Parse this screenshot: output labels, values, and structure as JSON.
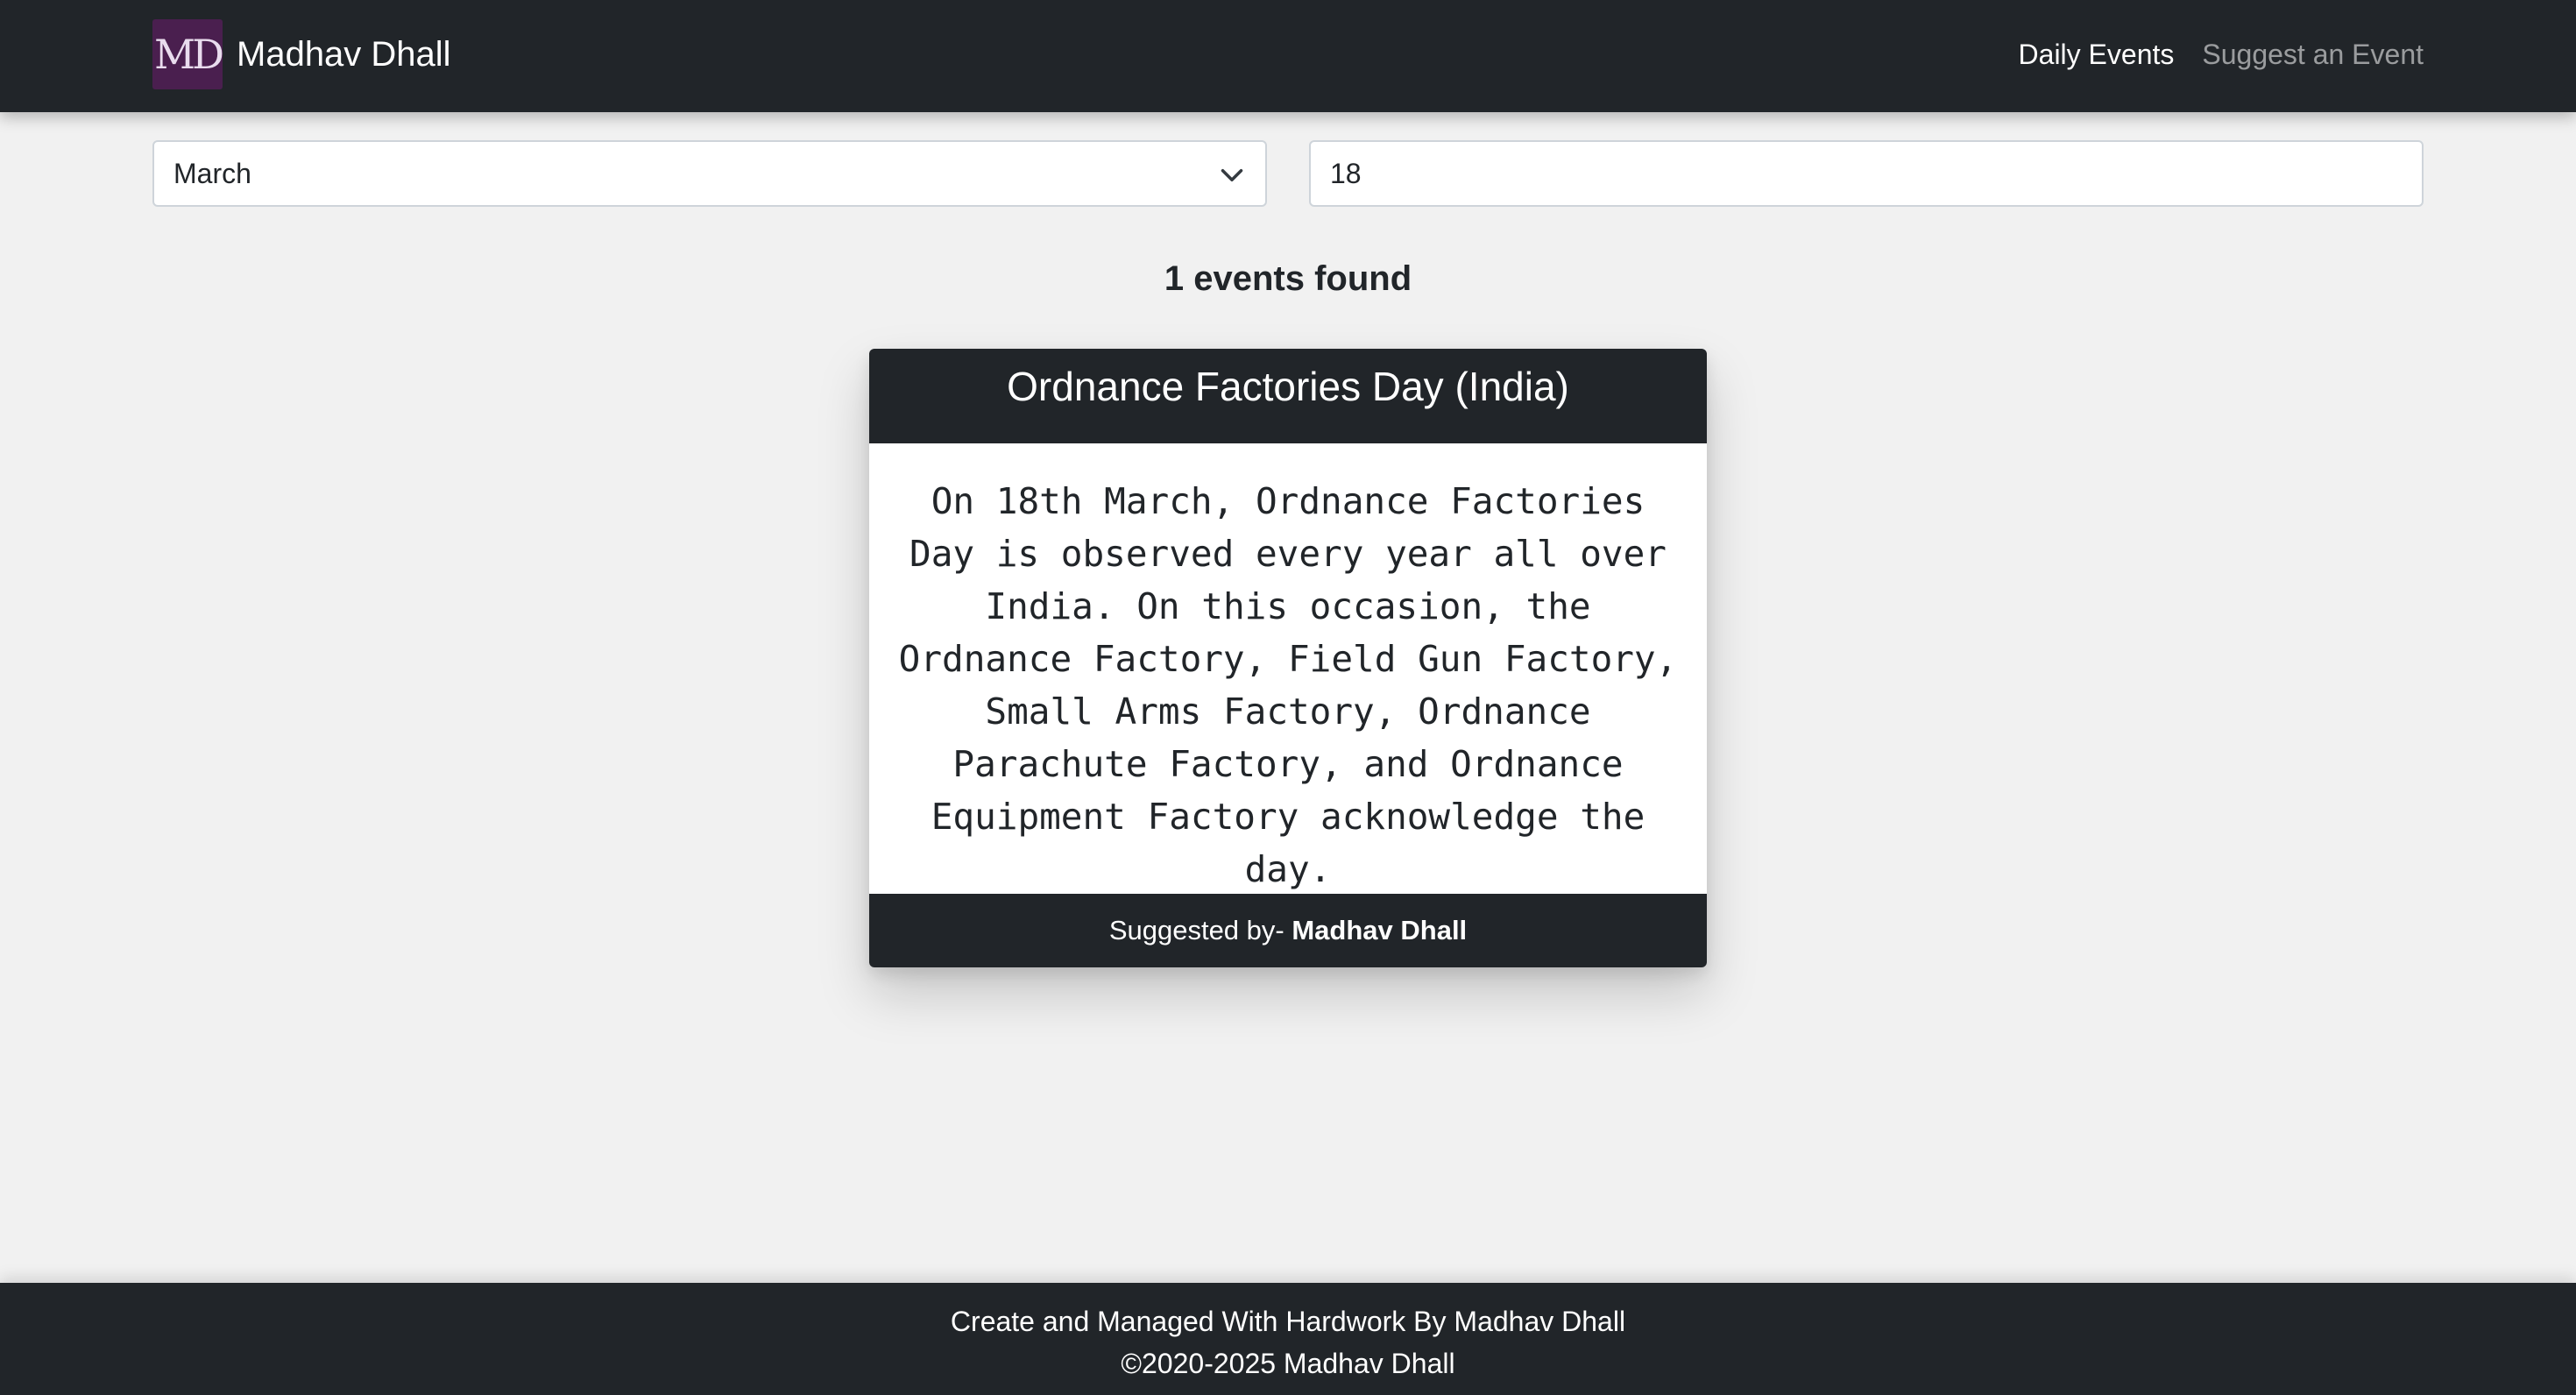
{
  "navbar": {
    "logo_text": "MD",
    "brand_name": "Madhav Dhall",
    "links": [
      {
        "label": "Daily Events",
        "active": true
      },
      {
        "label": "Suggest an Event",
        "active": false
      }
    ]
  },
  "filters": {
    "month_selected": "March",
    "day_value": "18"
  },
  "results": {
    "count_text": "1 events found"
  },
  "event_card": {
    "title": "Ordnance Factories Day (India)",
    "description": "On 18th March, Ordnance Factories Day is observed every year all over India. On this occasion, the Ordnance Factory, Field Gun Factory, Small Arms Factory, Ordnance Parachute Factory, and Ordnance Equipment Factory acknowledge the day.",
    "suggested_prefix": "Suggested by- ",
    "suggested_by": "Madhav Dhall"
  },
  "footer": {
    "line1": "Create and Managed With Hardwork By Madhav Dhall",
    "line2": "©2020-2025 Madhav Dhall"
  },
  "colors": {
    "navbar_bg": "#212529",
    "page_bg": "#f1f1f1",
    "logo_bg": "#4a1f4f",
    "card_bg": "#ffffff"
  },
  "icons": {
    "month_dropdown": "chevron-down-icon"
  }
}
